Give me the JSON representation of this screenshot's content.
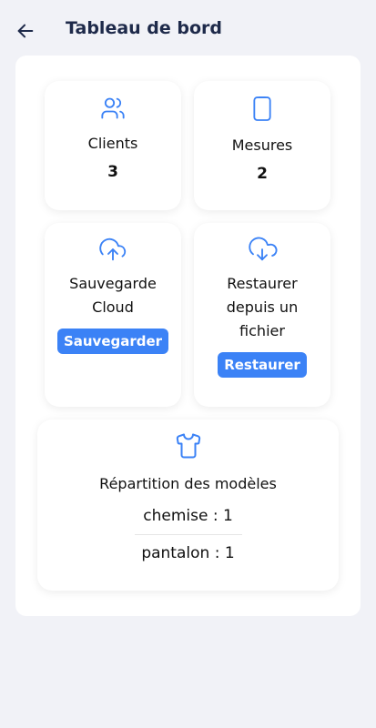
{
  "header": {
    "title": "Tableau de bord"
  },
  "stats": {
    "clients": {
      "label": "Clients",
      "count": "3",
      "icon": "users-icon"
    },
    "measures": {
      "label": "Mesures",
      "count": "2",
      "icon": "clipboard-icon"
    }
  },
  "backup": {
    "title_line1": "Sauvegarde",
    "title_line2": "Cloud",
    "button": "Sauvegarder",
    "icon": "cloud-upload-icon"
  },
  "restore": {
    "title_line1": "Restaurer",
    "title_line2": "depuis un",
    "title_line3": "fichier",
    "button": "Restaurer",
    "icon": "cloud-download-icon"
  },
  "models": {
    "title": "Répartition des modèles",
    "icon": "shirt-icon",
    "items": [
      "chemise : 1",
      "pantalon : 1"
    ]
  },
  "colors": {
    "accent": "#3b82f6",
    "title": "#1e2a4a",
    "background": "#f1f2f7"
  }
}
